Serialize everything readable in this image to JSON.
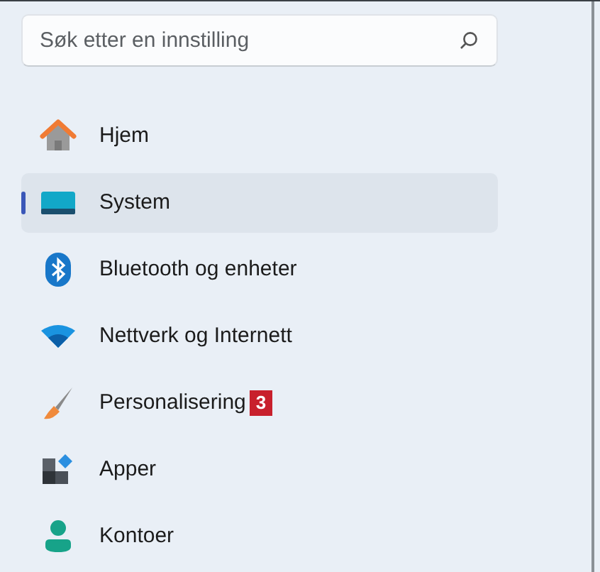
{
  "search": {
    "placeholder": "Søk etter en innstilling"
  },
  "nav": [
    {
      "label": "Hjem",
      "kind": "home",
      "selected": false
    },
    {
      "label": "System",
      "kind": "system",
      "selected": true
    },
    {
      "label": "Bluetooth og enheter",
      "kind": "bluetooth",
      "selected": false
    },
    {
      "label": "Nettverk og Internett",
      "kind": "network",
      "selected": false
    },
    {
      "label": "Personalisering",
      "kind": "brush",
      "selected": false,
      "badge": "3"
    },
    {
      "label": "Apper",
      "kind": "apps",
      "selected": false
    },
    {
      "label": "Kontoer",
      "kind": "account",
      "selected": false
    }
  ]
}
